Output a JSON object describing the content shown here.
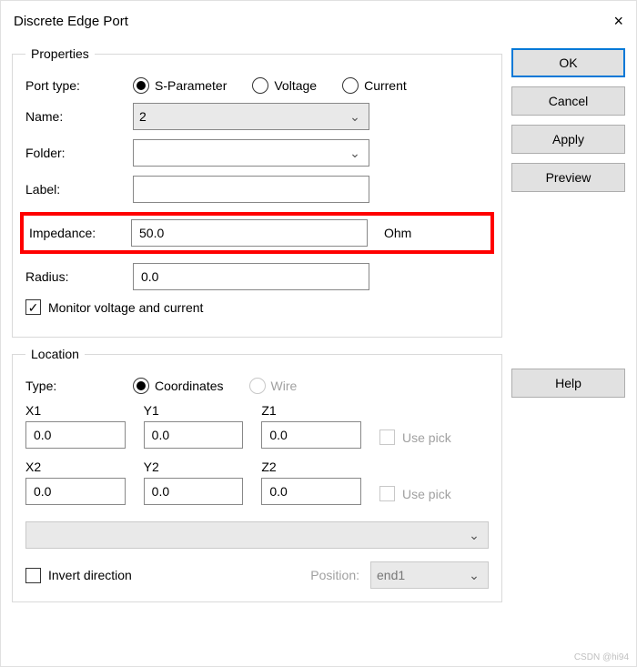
{
  "window": {
    "title": "Discrete Edge Port"
  },
  "groups": {
    "properties": "Properties",
    "location": "Location"
  },
  "labels": {
    "port_type": "Port type:",
    "name": "Name:",
    "folder": "Folder:",
    "label": "Label:",
    "impedance": "Impedance:",
    "radius": "Radius:",
    "monitor": "Monitor voltage and current",
    "type": "Type:",
    "x1": "X1",
    "y1": "Y1",
    "z1": "Z1",
    "x2": "X2",
    "y2": "Y2",
    "z2": "Z2",
    "use_pick": "Use pick",
    "invert": "Invert direction",
    "position": "Position:",
    "ohm": "Ohm"
  },
  "port_type_opts": {
    "sparam": "S-Parameter",
    "voltage": "Voltage",
    "current": "Current"
  },
  "loc_type_opts": {
    "coords": "Coordinates",
    "wire": "Wire"
  },
  "values": {
    "name": "2",
    "folder": "",
    "label": "",
    "impedance": "50.0",
    "radius": "0.0",
    "x1": "0.0",
    "y1": "0.0",
    "z1": "0.0",
    "x2": "0.0",
    "y2": "0.0",
    "z2": "0.0",
    "position": "end1",
    "monitor_checked": "✓"
  },
  "buttons": {
    "ok": "OK",
    "cancel": "Cancel",
    "apply": "Apply",
    "preview": "Preview",
    "help": "Help"
  },
  "watermark": "CSDN @hi94"
}
